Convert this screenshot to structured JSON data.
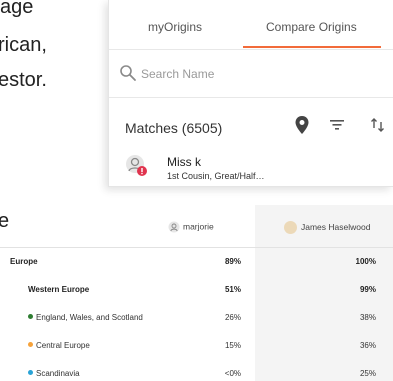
{
  "background": {
    "lines": [
      "age",
      "rican,",
      "estor."
    ]
  },
  "popup": {
    "tabs": [
      {
        "label": "myOrigins",
        "active": false
      },
      {
        "label": "Compare Origins",
        "active": true
      }
    ],
    "search": {
      "placeholder": "Search Name",
      "value": ""
    },
    "matches_label": "Matches (6505)",
    "match": {
      "name": "Miss k",
      "relationship": "1st Cousin, Great/Half…"
    },
    "accent_color": "#f26b3a"
  },
  "comparison": {
    "header_partial": "e",
    "user_a": "marjorie",
    "user_b": "James Haselwood",
    "rows": [
      {
        "label": "Europe",
        "a": "89%",
        "b": "100%",
        "level": 0,
        "bold": true
      },
      {
        "label": "Western Europe",
        "a": "51%",
        "b": "99%",
        "level": 1,
        "bold": true
      },
      {
        "label": "England, Wales, and Scotland",
        "a": "26%",
        "b": "38%",
        "level": 2,
        "dot_color": "#2e7d32"
      },
      {
        "label": "Central Europe",
        "a": "15%",
        "b": "36%",
        "level": 2,
        "dot_color": "#f6a23a"
      },
      {
        "label": "Scandinavia",
        "a": "<0%",
        "b": "25%",
        "level": 2,
        "dot_color": "#29a3d6"
      }
    ]
  }
}
